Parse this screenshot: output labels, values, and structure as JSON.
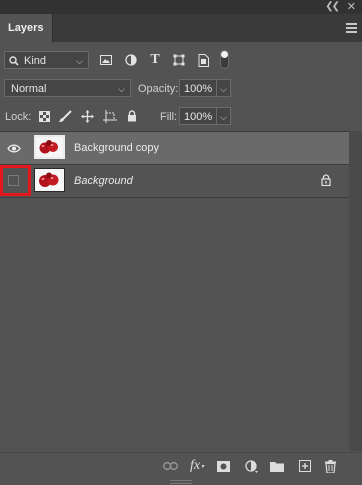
{
  "panel": {
    "tab_label": "Layers"
  },
  "filter": {
    "kind_label": "Kind",
    "icons": [
      "image-filter-icon",
      "adjustment-filter-icon",
      "type-filter-icon",
      "shape-filter-icon",
      "smart-object-filter-icon",
      "filter-toggle-icon"
    ]
  },
  "blend": {
    "mode": "Normal",
    "opacity_label": "Opacity:",
    "opacity_value": "100%"
  },
  "lock": {
    "label": "Lock:",
    "fill_label": "Fill:",
    "fill_value": "100%"
  },
  "layers": [
    {
      "name": "Background copy",
      "visible": true,
      "selected": true
    },
    {
      "name": "Background",
      "visible": false,
      "selected": false,
      "locked": true
    }
  ],
  "colors": {
    "panel_bg": "#535353",
    "selected_row": "#6a6a6a",
    "highlight": "#e5171e"
  }
}
